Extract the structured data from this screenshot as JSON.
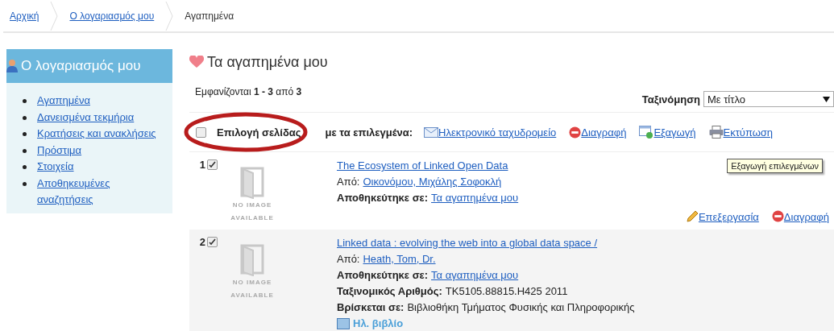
{
  "breadcrumb": [
    {
      "label": "Αρχική",
      "link": true
    },
    {
      "label": "Ο λογαριασμός μου",
      "link": true
    },
    {
      "label": "Αγαπημένα",
      "link": false
    }
  ],
  "sidebar": {
    "title": "Ο λογαριασμός μου",
    "items": [
      {
        "label": "Αγαπημένα"
      },
      {
        "label": "Δανεισμένα τεκμήρια"
      },
      {
        "label": "Κρατήσεις και ανακλήσεις"
      },
      {
        "label": "Πρόστιμα"
      },
      {
        "label": "Στοιχεία"
      },
      {
        "label": "Αποθηκευμένες αναζητήσεις"
      }
    ]
  },
  "heading": "Τα αγαπημένα μου",
  "results_summary": "Εμφανίζονται **1 - 3** από **3**",
  "sort": {
    "label": "Ταξινόμηση",
    "value": "Με τίτλο"
  },
  "toolbar": {
    "select_page": {
      "label": "Επιλογή σελίδας",
      "checked": false
    },
    "with_selected": "με τα επιλεγμένα:",
    "actions": [
      {
        "kind": "email",
        "label": "Ηλεκτρονικό ταχυδρομείο"
      },
      {
        "kind": "delete",
        "label": "Διαγραφή"
      },
      {
        "kind": "export",
        "label": "Εξαγωγή"
      },
      {
        "kind": "print",
        "label": "Εκτύπωση"
      }
    ]
  },
  "tooltip": "Εξαγωγή επιλεγμένων",
  "items": [
    {
      "number": "1",
      "checked": true,
      "cover_text": [
        "NO IMAGE",
        "AVAILABLE"
      ],
      "title": "The Ecosystem of Linked Open Data",
      "fields": [
        {
          "label": "Από:",
          "bold": false,
          "value": "Οικονόμου, Μιχάλης Σοφοκλή",
          "link": true
        },
        {
          "label": "Αποθηκεύτηκε σε:",
          "bold": true,
          "value": "Τα αγαπημένα μου",
          "link": true
        }
      ],
      "actions": [
        {
          "kind": "edit",
          "label": "Επεξεργασία"
        },
        {
          "kind": "delete",
          "label": "Διαγραφή"
        }
      ]
    },
    {
      "number": "2",
      "checked": true,
      "cover_text": [
        "NO IMAGE",
        "AVAILABLE"
      ],
      "title": "Linked data : evolving the web into a global data space /",
      "fields": [
        {
          "label": "Από:",
          "bold": false,
          "value": "Heath, Tom, Dr.",
          "link": true
        },
        {
          "label": "Αποθηκεύτηκε σε:",
          "bold": true,
          "value": "Τα αγαπημένα μου",
          "link": true
        },
        {
          "label": "Ταξινομικός Αριθμός:",
          "bold": true,
          "value": "TK5105.88815.H425 2011",
          "link": false
        },
        {
          "label": "Βρίσκεται σε:",
          "bold": true,
          "value": "Βιβλιοθήκη Τμήματος Φυσικής και Πληροφορικής",
          "link": false
        }
      ],
      "ebook": "Ηλ. βιβλίο"
    }
  ]
}
